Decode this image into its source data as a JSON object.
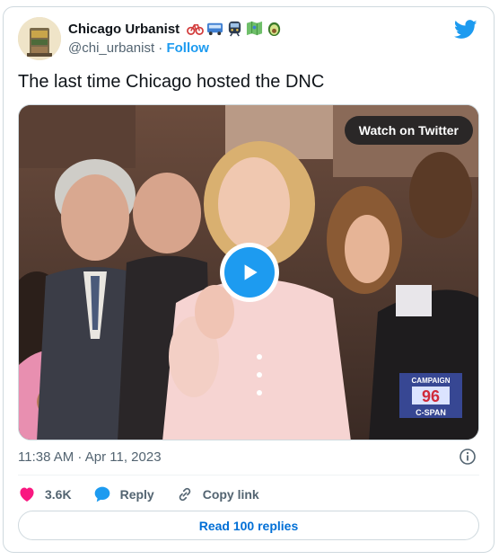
{
  "author": {
    "display_name": "Chicago Urbanist",
    "emoji_icons": [
      "bicycle-icon",
      "bus-icon",
      "metro-icon",
      "map-icon",
      "avocado-icon"
    ],
    "handle": "@chi_urbanist",
    "separator": "·",
    "follow_label": "Follow"
  },
  "tweet": {
    "text": "The last time Chicago hosted the DNC",
    "timestamp": "11:38 AM · Apr 11, 2023"
  },
  "media": {
    "watch_label": "Watch on Twitter",
    "overlay_logo_text": [
      "CAMPAIGN",
      "96",
      "C-SPAN"
    ]
  },
  "actions": {
    "likes_count": "3.6K",
    "reply_label": "Reply",
    "copy_link_label": "Copy link"
  },
  "read_replies_label": "Read 100 replies",
  "colors": {
    "twitter_blue": "#1d9bf0",
    "link_blue": "#006fd6",
    "like_red": "#f91880",
    "secondary_text": "#536471"
  }
}
